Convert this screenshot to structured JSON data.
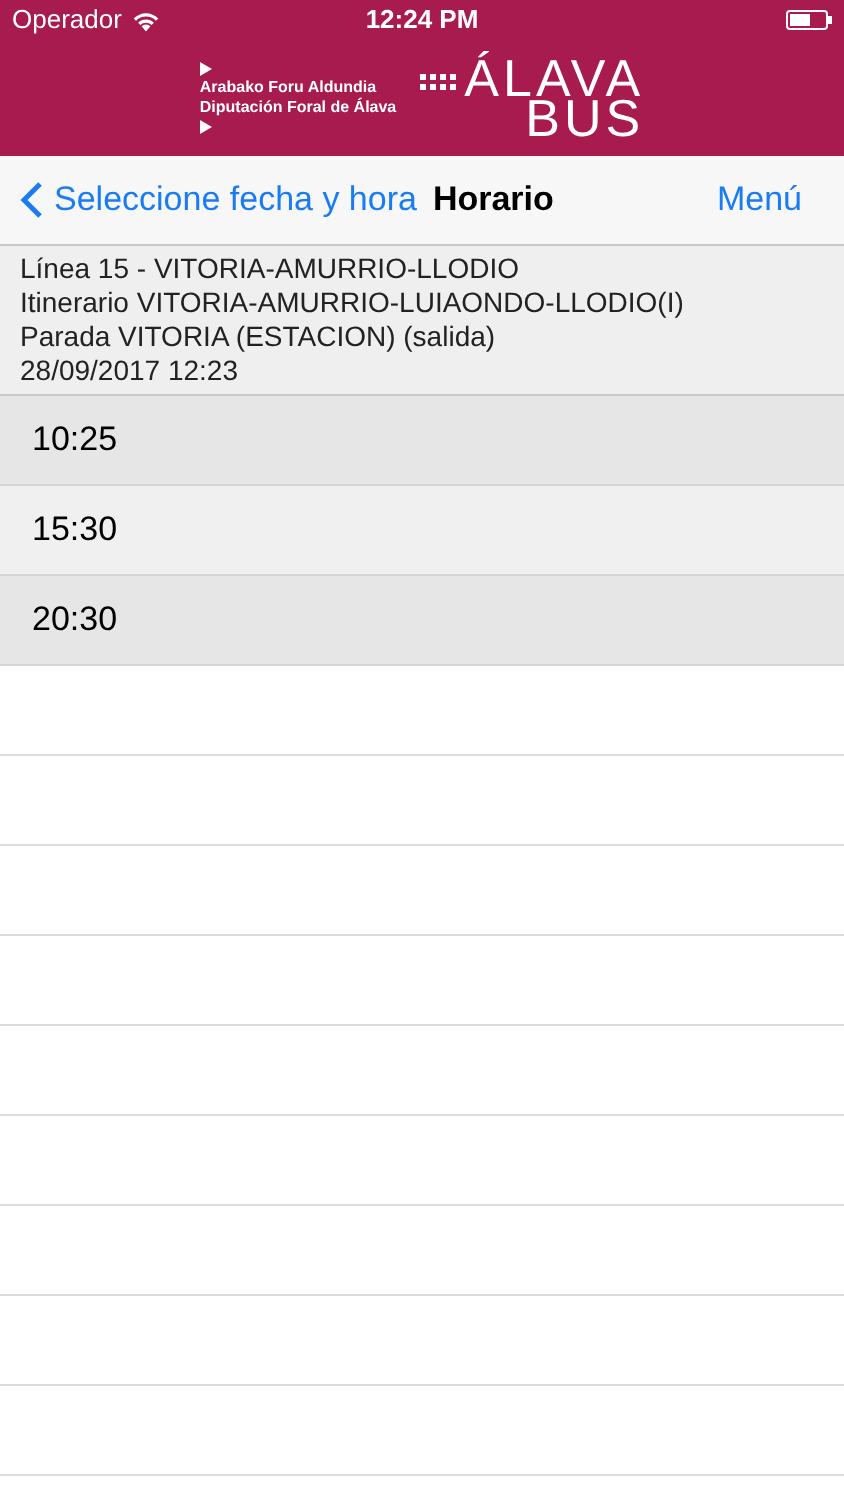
{
  "status_bar": {
    "carrier": "Operador",
    "time": "12:24 PM"
  },
  "header": {
    "org_lines": [
      "Arabako Foru Aldundia",
      "Diputación Foral de Álava"
    ],
    "brand_top": "ÁLAVA",
    "brand_bottom": "BUS"
  },
  "nav": {
    "back": "Seleccione fecha y hora",
    "title": "Horario",
    "menu": "Menú"
  },
  "info": [
    "Línea 15 - VITORIA-AMURRIO-LLODIO",
    "Itinerario VITORIA-AMURRIO-LUIAONDO-LLODIO(I)",
    "Parada VITORIA (ESTACION) (salida)",
    "28/09/2017 12:23"
  ],
  "times": [
    "10:25",
    "15:30",
    "20:30"
  ]
}
